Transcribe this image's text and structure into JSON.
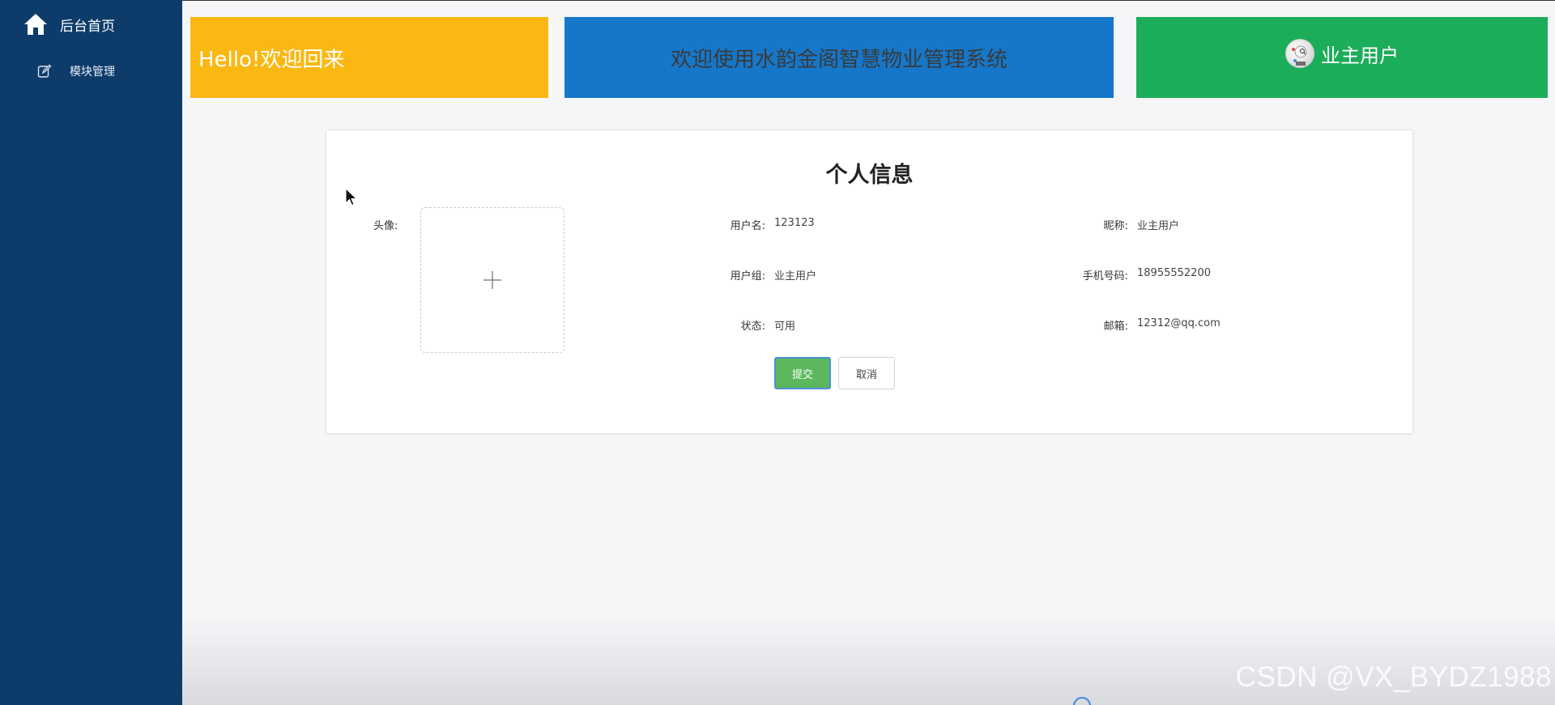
{
  "sidebar": {
    "home": {
      "label": "后台首页",
      "icon": "home-icon"
    },
    "items": [
      {
        "label": "模块管理",
        "icon": "edit-icon"
      }
    ]
  },
  "banners": {
    "hello": "Hello!欢迎回来",
    "welcome": "欢迎使用水韵金阁智慧物业管理系统",
    "user": "业主用户"
  },
  "profile": {
    "title": "个人信息",
    "avatar_label": "头像:",
    "fields": {
      "username": {
        "label": "用户名:",
        "value": "123123"
      },
      "nickname": {
        "label": "昵称:",
        "value": "业主用户"
      },
      "user_group": {
        "label": "用户组:",
        "value": "业主用户"
      },
      "phone": {
        "label": "手机号码:",
        "value": "18955552200"
      },
      "status": {
        "label": "状态:",
        "value": "可用"
      },
      "email": {
        "label": "邮箱:",
        "value": "12312@qq.com"
      }
    },
    "submit_label": "提交",
    "cancel_label": "取消"
  },
  "watermark": "CSDN @VX_BYDZ1988",
  "colors": {
    "sidebar": "#0d3c6b",
    "hello_banner": "#fbb812",
    "welcome_banner": "#1577c9",
    "user_banner": "#1cad5a",
    "submit_button": "#5cb85c"
  }
}
